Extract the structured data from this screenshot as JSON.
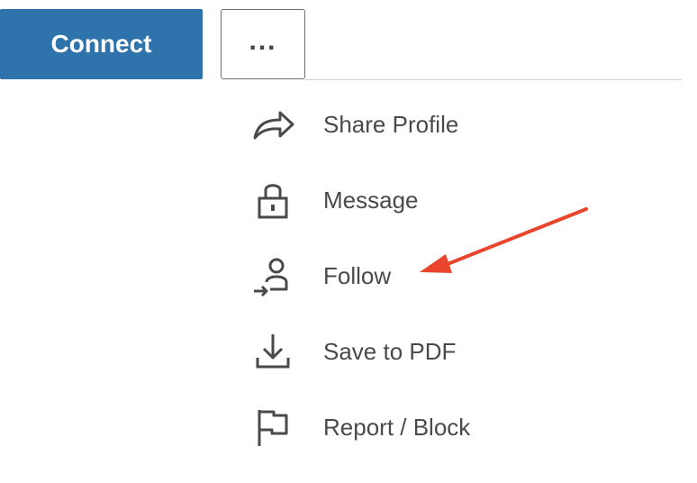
{
  "header": {
    "connect_label": "Connect",
    "more_label": "...",
    "connect_color": "#2f73ad"
  },
  "menu": {
    "items": [
      {
        "label": "Share Profile",
        "icon": "share-arrow-icon"
      },
      {
        "label": "Message",
        "icon": "lock-icon"
      },
      {
        "label": "Follow",
        "icon": "follow-person-icon"
      },
      {
        "label": "Save to PDF",
        "icon": "download-icon"
      },
      {
        "label": "Report / Block",
        "icon": "flag-icon"
      }
    ]
  },
  "annotation": {
    "arrow_color": "#e8452c",
    "points_to": "Follow"
  }
}
